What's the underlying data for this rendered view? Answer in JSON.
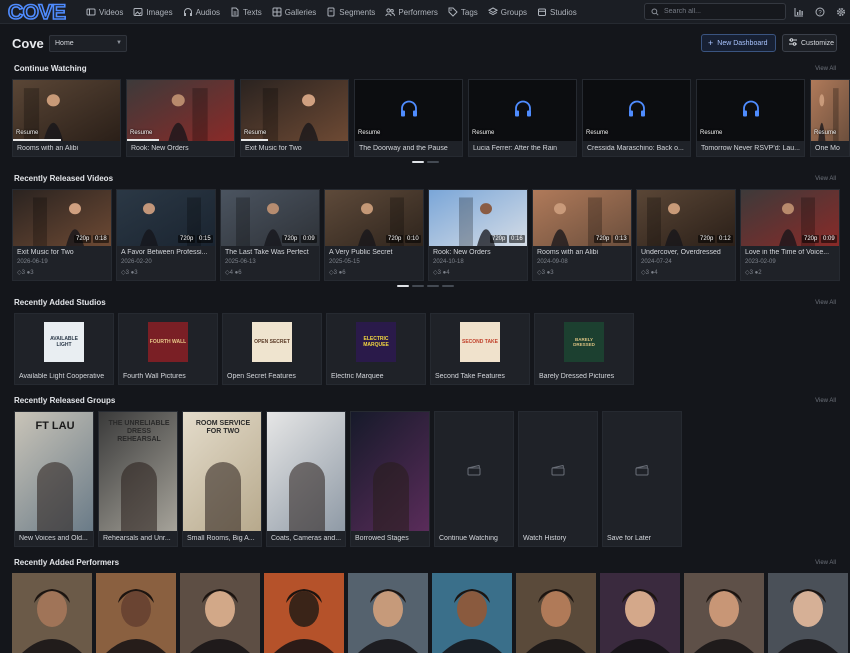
{
  "brand": {
    "logo_text": "COVE",
    "accent": "#4f8cff"
  },
  "nav": [
    {
      "label": "Videos",
      "icon": "film-icon"
    },
    {
      "label": "Images",
      "icon": "image-icon"
    },
    {
      "label": "Audios",
      "icon": "headphones-icon"
    },
    {
      "label": "Texts",
      "icon": "document-icon"
    },
    {
      "label": "Galleries",
      "icon": "gallery-icon"
    },
    {
      "label": "Segments",
      "icon": "bookmark-icon"
    },
    {
      "label": "Performers",
      "icon": "users-icon"
    },
    {
      "label": "Tags",
      "icon": "tag-icon"
    },
    {
      "label": "Groups",
      "icon": "layers-icon"
    },
    {
      "label": "Studios",
      "icon": "studio-icon"
    }
  ],
  "search": {
    "placeholder": "Search all..."
  },
  "top_icons": [
    "stats-icon",
    "help-icon",
    "settings-icon"
  ],
  "header": {
    "title": "Cove",
    "dashboard_select": "Home",
    "new_dashboard_label": "New Dashboard",
    "customize_label": "Customize"
  },
  "sections": {
    "continue_watching": {
      "title": "Continue Watching",
      "view_all": "View All",
      "resume_label": "Resume",
      "items": [
        {
          "title": "Rooms with an Alibi",
          "kind": "video",
          "progress": 0.45
        },
        {
          "title": "Rook: New Orders",
          "kind": "video",
          "progress": 0.3
        },
        {
          "title": "Exit Music for Two",
          "kind": "video",
          "progress": 0.25
        },
        {
          "title": "The Doorway and the Pause",
          "kind": "audio",
          "progress": 0.0
        },
        {
          "title": "Lucia Ferrer: After the Rain",
          "kind": "audio",
          "progress": 0.0
        },
        {
          "title": "Cressida Maraschino: Back o...",
          "kind": "audio",
          "progress": 0.0
        },
        {
          "title": "Tomorrow Never RSVP'd: Lau...",
          "kind": "audio",
          "progress": 0.0
        },
        {
          "title": "One Mo",
          "kind": "video",
          "progress": 0.0
        }
      ]
    },
    "recent_videos": {
      "title": "Recently Released Videos",
      "view_all": "View All",
      "items": [
        {
          "title": "Exit Music for Two",
          "date": "2026-06-19",
          "res": "720p",
          "duration": "0:18",
          "stat1": "3",
          "stat2": "3"
        },
        {
          "title": "A Favor Between Professi...",
          "date": "2026-02-20",
          "res": "720p",
          "duration": "0:15",
          "stat1": "3",
          "stat2": "3"
        },
        {
          "title": "The Last Take Was Perfect",
          "date": "2025-06-13",
          "res": "720p",
          "duration": "0:09",
          "stat1": "4",
          "stat2": "6"
        },
        {
          "title": "A Very Public Secret",
          "date": "2025-05-15",
          "res": "720p",
          "duration": "0:10",
          "stat1": "3",
          "stat2": "6"
        },
        {
          "title": "Rook: New Orders",
          "date": "2024-10-18",
          "res": "720p",
          "duration": "0:16",
          "stat1": "3",
          "stat2": "4"
        },
        {
          "title": "Rooms with an Alibi",
          "date": "2024-09-08",
          "res": "720p",
          "duration": "0:13",
          "stat1": "3",
          "stat2": "3"
        },
        {
          "title": "Undercover, Overdressed",
          "date": "2024-07-24",
          "res": "720p",
          "duration": "0:12",
          "stat1": "3",
          "stat2": "4"
        },
        {
          "title": "Love in the Time of Voice...",
          "date": "2023-02-09",
          "res": "720p",
          "duration": "0:09",
          "stat1": "3",
          "stat2": "2"
        }
      ]
    },
    "studios": {
      "title": "Recently Added Studios",
      "view_all": "View All",
      "items": [
        {
          "name": "Available Light Cooperative",
          "logo_text": "AVAILABLE LIGHT"
        },
        {
          "name": "Fourth Wall Pictures",
          "logo_text": "FOURTH WALL"
        },
        {
          "name": "Open Secret Features",
          "logo_text": "OPEN SECRET"
        },
        {
          "name": "Electric Marquee",
          "logo_text": "ELECTRIC MARQUEE"
        },
        {
          "name": "Second Take Features",
          "logo_text": "SECOND TAKE"
        },
        {
          "name": "Barely Dressed Pictures",
          "logo_text": "BARELY DRESSED"
        }
      ]
    },
    "groups": {
      "title": "Recently Released Groups",
      "view_all": "View All",
      "items": [
        {
          "name": "New Voices and Old...",
          "cover_text": "FT LAU"
        },
        {
          "name": "Rehearsals and Unr...",
          "cover_text": "THE UNRELIABLE DRESS REHEARSAL"
        },
        {
          "name": "Small Rooms, Big A...",
          "cover_text": "ROOM SERVICE FOR TWO"
        },
        {
          "name": "Coats, Cameras and...",
          "cover_text": ""
        },
        {
          "name": "Borrowed Stages",
          "cover_text": ""
        },
        {
          "name": "Continue Watching",
          "cover_text": ""
        },
        {
          "name": "Watch History",
          "cover_text": ""
        },
        {
          "name": "Save for Later",
          "cover_text": ""
        }
      ]
    },
    "performers": {
      "title": "Recently Added Performers",
      "view_all": "View All",
      "count": 10
    }
  }
}
